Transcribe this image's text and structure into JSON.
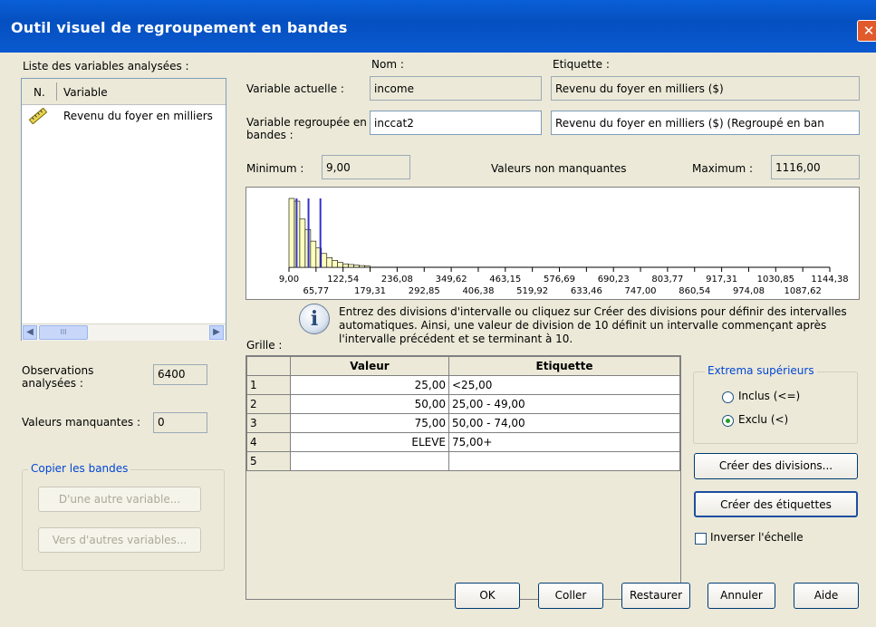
{
  "window": {
    "title": "Outil visuel de regroupement en bandes",
    "close": "✕"
  },
  "left": {
    "list_label": "Liste des variables analysées :",
    "list_headers": {
      "n": "N.",
      "variable": "Variable"
    },
    "variables": [
      {
        "name": "Revenu du foyer en milliers"
      }
    ],
    "scroll_thumb": "III",
    "observations_label": "Observations analysées :",
    "observations_value": "6400",
    "missing_label": "Valeurs manquantes :",
    "missing_value": "0",
    "copy_group": "Copier les bandes",
    "copy_from": "D'une autre variable...",
    "copy_to": "Vers d'autres variables..."
  },
  "vars": {
    "nom_header": "Nom :",
    "etiquette_header": "Etiquette :",
    "current_label": "Variable actuelle :",
    "current_name": "income",
    "current_etiquette": "Revenu du foyer en milliers ($)",
    "grouped_label": "Variable regroupée en bandes :",
    "grouped_name": "inccat2",
    "grouped_etiquette": "Revenu du foyer en milliers ($) (Regroupé en ban"
  },
  "stats": {
    "minimum_label": "Minimum :",
    "minimum_value": "9,00",
    "nonmissing_label": "Valeurs non manquantes",
    "maximum_label": "Maximum :",
    "maximum_value": "1116,00"
  },
  "chart_data": {
    "type": "bar",
    "x_ticks_top": [
      "9,00",
      "122,54",
      "236,08",
      "349,62",
      "463,15",
      "576,69",
      "690,23",
      "803,77",
      "917,31",
      "1030,85",
      "1144,38"
    ],
    "x_ticks_bottom": [
      "65,77",
      "179,31",
      "292,85",
      "406,38",
      "519,92",
      "633,46",
      "747,00",
      "860,54",
      "974,08",
      "1087,62"
    ],
    "xlim": [
      9.0,
      1144.38
    ],
    "bins": [
      {
        "x0": 9,
        "x1": 20.35,
        "rel_height": 1.0
      },
      {
        "x0": 20.35,
        "x1": 31.7,
        "rel_height": 0.96
      },
      {
        "x0": 31.7,
        "x1": 43.05,
        "rel_height": 0.7
      },
      {
        "x0": 43.05,
        "x1": 54.4,
        "rel_height": 0.55
      },
      {
        "x0": 54.4,
        "x1": 65.75,
        "rel_height": 0.38
      },
      {
        "x0": 65.75,
        "x1": 77.1,
        "rel_height": 0.28
      },
      {
        "x0": 77.1,
        "x1": 88.45,
        "rel_height": 0.2
      },
      {
        "x0": 88.45,
        "x1": 99.8,
        "rel_height": 0.14
      },
      {
        "x0": 99.8,
        "x1": 111.15,
        "rel_height": 0.1
      },
      {
        "x0": 111.15,
        "x1": 122.5,
        "rel_height": 0.07
      },
      {
        "x0": 122.5,
        "x1": 133.85,
        "rel_height": 0.05
      },
      {
        "x0": 133.85,
        "x1": 145.2,
        "rel_height": 0.04
      },
      {
        "x0": 145.2,
        "x1": 156.55,
        "rel_height": 0.03
      },
      {
        "x0": 156.55,
        "x1": 167.9,
        "rel_height": 0.025
      },
      {
        "x0": 167.9,
        "x1": 179.25,
        "rel_height": 0.02
      }
    ],
    "cutpoints": [
      25,
      50,
      75
    ],
    "colors": {
      "bar": "#ffffc0",
      "cut": "#3333cc",
      "axis": "#000000"
    }
  },
  "info": {
    "text": "Entrez des divisions d'intervalle ou cliquez sur Créer des divisions pour définir des intervalles automatiques. Ainsi, une valeur de division de 10 définit un intervalle commençant après l'intervalle précédent et se terminant à 10."
  },
  "grid": {
    "label": "Grille :",
    "headers": {
      "valeur": "Valeur",
      "etiquette": "Etiquette"
    },
    "rows": [
      {
        "n": "1",
        "valeur": "25,00",
        "etiquette": "<25,00"
      },
      {
        "n": "2",
        "valeur": "50,00",
        "etiquette": "25,00 - 49,00"
      },
      {
        "n": "3",
        "valeur": "75,00",
        "etiquette": "50,00 - 74,00"
      },
      {
        "n": "4",
        "valeur": "ELEVE",
        "etiquette": "75,00+"
      },
      {
        "n": "5",
        "valeur": "",
        "etiquette": ""
      }
    ]
  },
  "extrema": {
    "title": "Extrema supérieurs",
    "inclus": "Inclus (<=)",
    "exclu": "Exclu (<)",
    "selected": "exclu"
  },
  "buttons": {
    "create_divisions": "Créer des divisions...",
    "create_labels": "Créer des étiquettes",
    "reverse_scale": "Inverser l'échelle",
    "ok": "OK",
    "paste": "Coller",
    "reset": "Restaurer",
    "cancel": "Annuler",
    "help": "Aide"
  }
}
